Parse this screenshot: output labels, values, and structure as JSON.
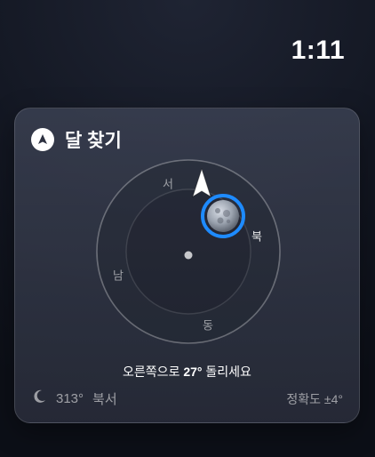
{
  "status_bar": {
    "time": "1:11"
  },
  "card": {
    "title": "달 찾기",
    "compass": {
      "directions": {
        "west": "서",
        "north": "북",
        "south": "남",
        "east": "동"
      }
    },
    "instruction": {
      "prefix": "오른쪽으로 ",
      "degrees": "27°",
      "suffix": " 돌리세요"
    },
    "footer": {
      "azimuth": "313°",
      "azimuth_direction": "북서",
      "accuracy": "정확도 ±4°"
    }
  },
  "icons": {
    "navigation": "navigation-arrow-icon",
    "moon_position": "moon-icon",
    "phone_heading": "direction-arrow-icon",
    "moon_phase": "crescent-moon-icon"
  },
  "colors": {
    "accent": "#1E8BFF",
    "card_bg": "#343846"
  }
}
